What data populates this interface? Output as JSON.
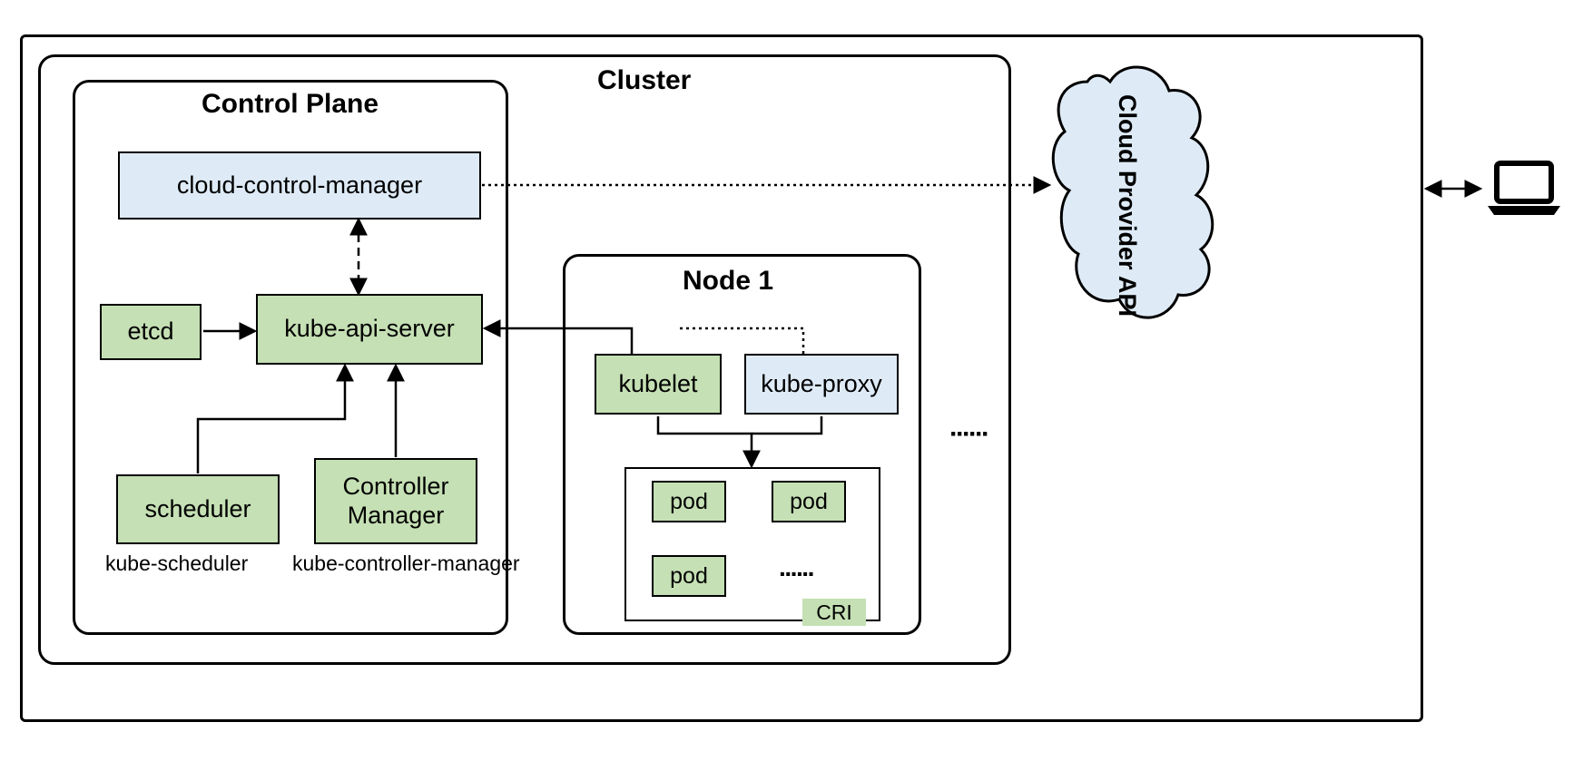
{
  "cluster": {
    "label": "Cluster"
  },
  "control_plane": {
    "label": "Control Plane",
    "ccm": "cloud-control-manager",
    "etcd": "etcd",
    "api": "kube-api-server",
    "scheduler": "scheduler",
    "scheduler_sub": "kube-scheduler",
    "controller": "Controller\nManager",
    "controller_sub": "kube-controller-manager"
  },
  "node": {
    "label": "Node 1",
    "kubelet": "kubelet",
    "kube_proxy": "kube-proxy",
    "pod1": "pod",
    "pod2": "pod",
    "pod3": "pod",
    "pod_dots": "······",
    "cri": "CRI"
  },
  "node_dots": "······",
  "cloud_api": "Cloud Provider API"
}
